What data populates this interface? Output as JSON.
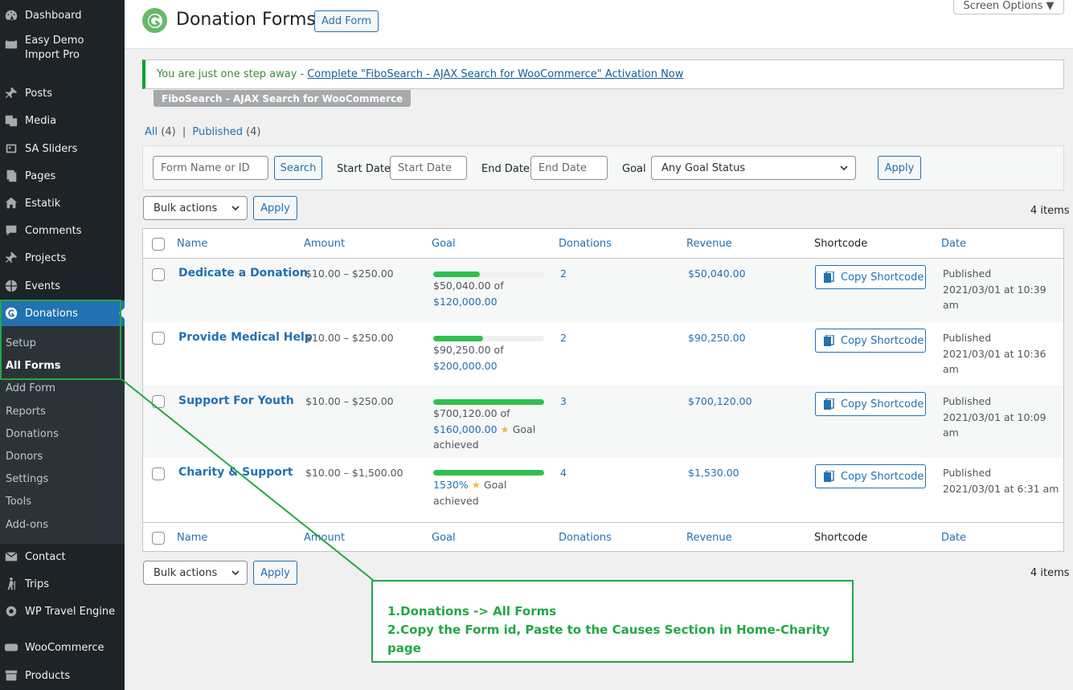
{
  "sidebar": {
    "items": [
      {
        "label": "Dashboard",
        "icon": "dashboard-icon"
      },
      {
        "label": "Easy Demo Import Pro",
        "icon": "import-icon"
      },
      {
        "label": "Posts",
        "icon": "pin-icon"
      },
      {
        "label": "Media",
        "icon": "media-icon"
      },
      {
        "label": "SA Sliders",
        "icon": "slides-icon"
      },
      {
        "label": "Pages",
        "icon": "pages-icon"
      },
      {
        "label": "Estatik",
        "icon": "home-icon"
      },
      {
        "label": "Comments",
        "icon": "comment-icon"
      },
      {
        "label": "Projects",
        "icon": "pin-icon"
      },
      {
        "label": "Events",
        "icon": "globe-icon"
      },
      {
        "label": "Donations",
        "icon": "give-icon"
      },
      {
        "label": "Contact",
        "icon": "mail-icon"
      },
      {
        "label": "Trips",
        "icon": "hiker-icon"
      },
      {
        "label": "WP Travel Engine",
        "icon": "gear-icon"
      },
      {
        "label": "WooCommerce",
        "icon": "woo-icon"
      },
      {
        "label": "Products",
        "icon": "archive-icon"
      }
    ],
    "submenu": [
      "Setup",
      "All Forms",
      "Add Form",
      "Reports",
      "Donations",
      "Donors",
      "Settings",
      "Tools",
      "Add-ons"
    ]
  },
  "header": {
    "title": "Donation Forms",
    "add_form": "Add Form",
    "screen_options": "Screen Options ▼"
  },
  "notice": {
    "text": "You are just one step away -",
    "link": "Complete \"FiboSearch - AJAX Search for WooCommerce\" Activation Now",
    "tag": "FiboSearch - AJAX Search for WooCommerce"
  },
  "views": {
    "all": "All",
    "all_count": "(4)",
    "sep": "|",
    "published": "Published",
    "published_count": "(4)"
  },
  "filters": {
    "search_placeholder": "Form Name or ID",
    "search_btn": "Search",
    "start_label": "Start Date",
    "start_placeholder": "Start Date",
    "end_label": "End Date",
    "end_placeholder": "End Date",
    "goal_label": "Goal",
    "goal_select": "Any Goal Status",
    "apply": "Apply"
  },
  "bulk": {
    "label": "Bulk actions",
    "apply": "Apply",
    "items": "4 items"
  },
  "table": {
    "columns": [
      "Name",
      "Amount",
      "Goal",
      "Donations",
      "Revenue",
      "Shortcode",
      "Date"
    ],
    "copy_label": "Copy Shortcode",
    "rows": [
      {
        "name": "Dedicate a Donation",
        "amount": "$10.00 – $250.00",
        "goal_pct": 0.42,
        "goal_line1": "$50,040.00 of",
        "goal_link": "$120,000.00",
        "goal_tail": "",
        "donations": "2",
        "revenue": "$50,040.00",
        "status": "Published",
        "date": "2021/03/01 at 10:39 am"
      },
      {
        "name": "Provide Medical Help",
        "amount": "$10.00 – $250.00",
        "goal_pct": 0.45,
        "goal_line1": "$90,250.00 of",
        "goal_link": "$200,000.00",
        "goal_tail": "",
        "donations": "2",
        "revenue": "$90,250.00",
        "status": "Published",
        "date": "2021/03/01 at 10:36 am"
      },
      {
        "name": "Support For Youth",
        "amount": "$10.00 – $250.00",
        "goal_pct": 1.0,
        "goal_line1": "$700,120.00 of",
        "goal_link": "$160,000.00",
        "goal_tail": "Goal achieved",
        "donations": "3",
        "revenue": "$700,120.00",
        "status": "Published",
        "date": "2021/03/01 at 10:09 am"
      },
      {
        "name": "Charity & Support",
        "amount": "$10.00 – $1,500.00",
        "goal_pct": 1.0,
        "goal_line1": "",
        "goal_link": "1530%",
        "goal_tail": "Goal achieved",
        "donations": "4",
        "revenue": "$1,530.00",
        "status": "Published",
        "date": "2021/03/01 at 6:31 am"
      }
    ]
  },
  "annotation": {
    "line1": "1.Donations -> All Forms",
    "line2": "2.Copy the  Form id, Paste to the Causes Section in Home-Charity page",
    "color": "#22a745"
  },
  "colors": {
    "accent": "#2271b1",
    "sidebar": "#1d2327",
    "progress": "#2ec04f"
  }
}
